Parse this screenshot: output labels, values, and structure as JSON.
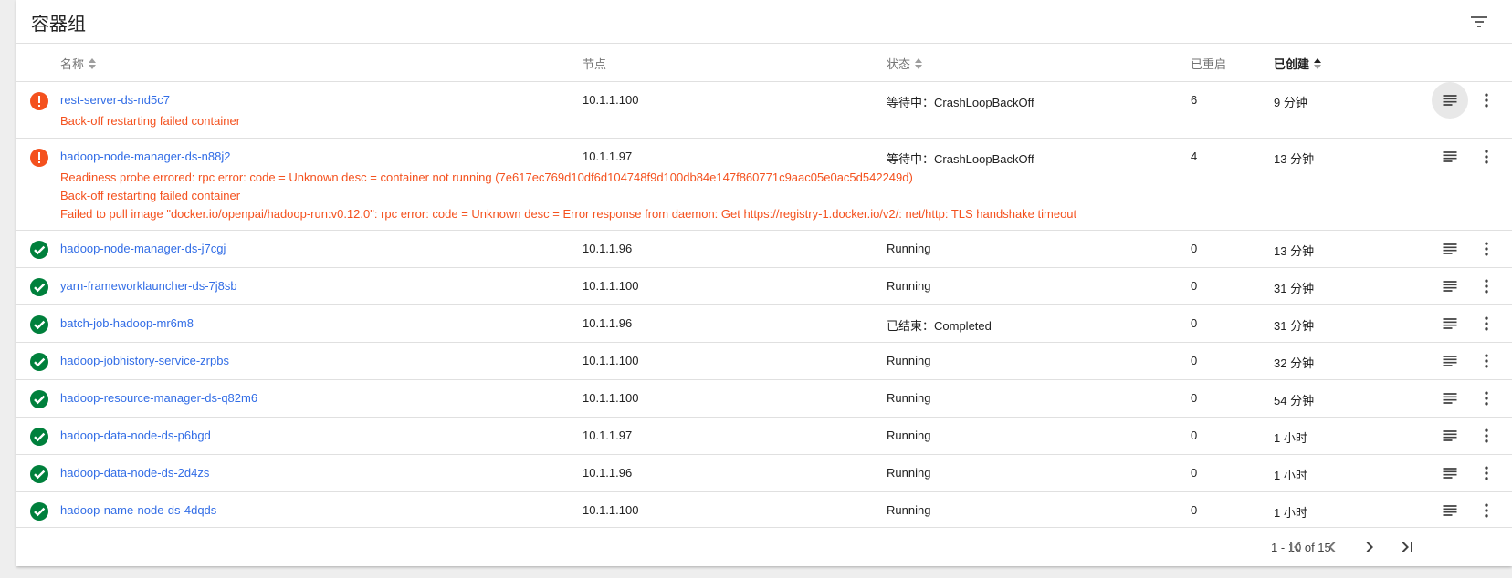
{
  "card": {
    "title": "容器组"
  },
  "columns": {
    "name": "名称",
    "node": "节点",
    "status": "状态",
    "restarts": "已重启",
    "created": "已创建"
  },
  "pods": [
    {
      "status_icon": "error-icon",
      "name": "rest-server-ds-nd5c7",
      "node": "10.1.1.100",
      "status": "等待中：CrashLoopBackOff",
      "restarts": "6",
      "created": "9 分钟",
      "messages": [
        "Back-off restarting failed container"
      ]
    },
    {
      "status_icon": "error-icon",
      "name": "hadoop-node-manager-ds-n88j2",
      "node": "10.1.1.97",
      "status": "等待中：CrashLoopBackOff",
      "restarts": "4",
      "created": "13 分钟",
      "messages": [
        "Readiness probe errored: rpc error: code = Unknown desc = container not running (7e617ec769d10df6d104748f9d100db84e147f860771c9aac05e0ac5d542249d)",
        "Back-off restarting failed container",
        "Failed to pull image \"docker.io/openpai/hadoop-run:v0.12.0\": rpc error: code = Unknown desc = Error response from daemon: Get https://registry-1.docker.io/v2/: net/http: TLS handshake timeout"
      ]
    },
    {
      "status_icon": "check-icon",
      "name": "hadoop-node-manager-ds-j7cgj",
      "node": "10.1.1.96",
      "status": "Running",
      "restarts": "0",
      "created": "13 分钟",
      "messages": []
    },
    {
      "status_icon": "check-icon",
      "name": "yarn-frameworklauncher-ds-7j8sb",
      "node": "10.1.1.100",
      "status": "Running",
      "restarts": "0",
      "created": "31 分钟",
      "messages": []
    },
    {
      "status_icon": "check-icon",
      "name": "batch-job-hadoop-mr6m8",
      "node": "10.1.1.96",
      "status": "已结束：Completed",
      "restarts": "0",
      "created": "31 分钟",
      "messages": []
    },
    {
      "status_icon": "check-icon",
      "name": "hadoop-jobhistory-service-zrpbs",
      "node": "10.1.1.100",
      "status": "Running",
      "restarts": "0",
      "created": "32 分钟",
      "messages": []
    },
    {
      "status_icon": "check-icon",
      "name": "hadoop-resource-manager-ds-q82m6",
      "node": "10.1.1.100",
      "status": "Running",
      "restarts": "0",
      "created": "54 分钟",
      "messages": []
    },
    {
      "status_icon": "check-icon",
      "name": "hadoop-data-node-ds-p6bgd",
      "node": "10.1.1.97",
      "status": "Running",
      "restarts": "0",
      "created": "1 小时",
      "messages": []
    },
    {
      "status_icon": "check-icon",
      "name": "hadoop-data-node-ds-2d4zs",
      "node": "10.1.1.96",
      "status": "Running",
      "restarts": "0",
      "created": "1 小时",
      "messages": []
    },
    {
      "status_icon": "check-icon",
      "name": "hadoop-name-node-ds-4dqds",
      "node": "10.1.1.100",
      "status": "Running",
      "restarts": "0",
      "created": "1 小时",
      "messages": []
    }
  ],
  "pagination": {
    "range": "1 - 10 of 15"
  },
  "colors": {
    "error": "#f4511e",
    "ok": "#00803c",
    "link": "#326de6"
  }
}
